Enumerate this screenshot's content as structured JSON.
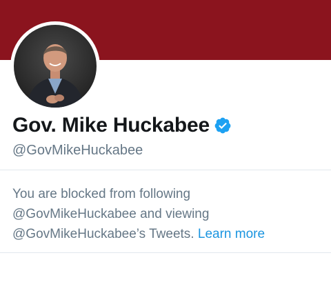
{
  "profile": {
    "display_name": "Gov. Mike Huckabee",
    "handle": "@GovMikeHuckabee",
    "verified": true
  },
  "blocked_notice": {
    "line1": "You are blocked from following",
    "line2": "@GovMikeHuckabee and viewing",
    "line3": "@GovMikeHuckabee’s Tweets.",
    "learn_more_label": "Learn more"
  },
  "colors": {
    "banner": "#8b141e",
    "name_text": "#14171a",
    "secondary_text": "#657786",
    "link": "#1b95e0",
    "verified_badge": "#1da1f2",
    "divider": "#e1e8ed"
  },
  "icons": {
    "verified": "verified-badge-icon"
  }
}
